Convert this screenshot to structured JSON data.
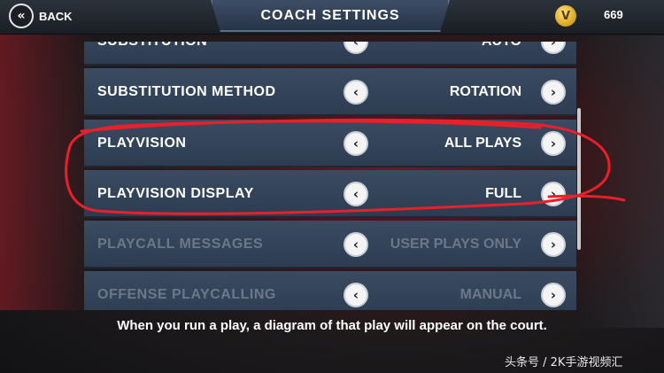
{
  "header": {
    "back_label": "BACK",
    "back_icon": "double-chevron-left-icon",
    "title": "COACH SETTINGS",
    "vc_icon_glyph": "V",
    "vc_amount": "669"
  },
  "settings": [
    {
      "label": "SUBSTITUTION",
      "value": "AUTO",
      "state": "partial"
    },
    {
      "label": "SUBSTITUTION METHOD",
      "value": "ROTATION",
      "state": "normal"
    },
    {
      "label": "PLAYVISION",
      "value": "ALL PLAYS",
      "state": "normal"
    },
    {
      "label": "PLAYVISION DISPLAY",
      "value": "FULL",
      "state": "normal"
    },
    {
      "label": "PLAYCALL MESSAGES",
      "value": "USER PLAYS ONLY",
      "state": "disabled"
    },
    {
      "label": "OFFENSE PLAYCALLING",
      "value": "MANUAL",
      "state": "disabled"
    }
  ],
  "arrows": {
    "left": "‹",
    "right": "›"
  },
  "description": "When you run a play, a diagram of that play will appear on the court.",
  "watermark": "头条号 / 2K手游视频汇",
  "colors": {
    "annotation": "#e8202a",
    "row_bg": "#34455b",
    "coin": "#e0aa22"
  }
}
